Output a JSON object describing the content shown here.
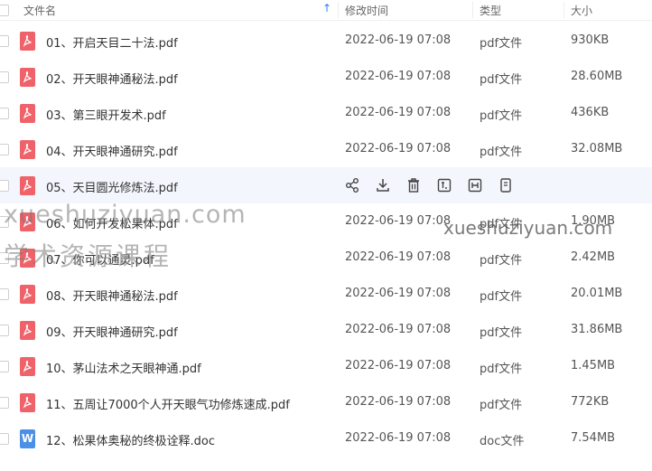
{
  "header": {
    "name_label": "文件名",
    "sort_indicator": "↑",
    "modified_label": "修改时间",
    "type_label": "类型",
    "size_label": "大小"
  },
  "files": [
    {
      "name": "01、开启天目二十法.pdf",
      "modified": "2022-06-19 07:08",
      "type": "pdf文件",
      "size": "930KB",
      "icon": "pdf-file-icon"
    },
    {
      "name": "02、开天眼神通秘法.pdf",
      "modified": "2022-06-19 07:08",
      "type": "pdf文件",
      "size": "28.60MB",
      "icon": "pdf-file-icon"
    },
    {
      "name": "03、第三眼开发术.pdf",
      "modified": "2022-06-19 07:08",
      "type": "pdf文件",
      "size": "436KB",
      "icon": "pdf-file-icon"
    },
    {
      "name": "04、开天眼神通研究.pdf",
      "modified": "2022-06-19 07:08",
      "type": "pdf文件",
      "size": "32.08MB",
      "icon": "pdf-file-icon"
    },
    {
      "name": "05、天目圆光修炼法.pdf",
      "modified": "",
      "type": "",
      "size": "",
      "icon": "pdf-file-icon",
      "hovered": true
    },
    {
      "name": "06、如何开发松果体.pdf",
      "modified": "2022-06-19 07:08",
      "type": "pdf文件",
      "size": "1.90MB",
      "icon": "pdf-file-icon"
    },
    {
      "name": "07、你可以通灵.pdf",
      "modified": "2022-06-19 07:08",
      "type": "pdf文件",
      "size": "2.42MB",
      "icon": "pdf-file-icon"
    },
    {
      "name": "08、开天眼神通秘法.pdf",
      "modified": "2022-06-19 07:08",
      "type": "pdf文件",
      "size": "20.01MB",
      "icon": "pdf-file-icon"
    },
    {
      "name": "09、开天眼神通研究.pdf",
      "modified": "2022-06-19 07:08",
      "type": "pdf文件",
      "size": "31.86MB",
      "icon": "pdf-file-icon"
    },
    {
      "name": "10、茅山法术之天眼神通.pdf",
      "modified": "2022-06-19 07:08",
      "type": "pdf文件",
      "size": "1.45MB",
      "icon": "pdf-file-icon"
    },
    {
      "name": "11、五周让7000个人开天眼气功修炼速成.pdf",
      "modified": "2022-06-19 07:08",
      "type": "pdf文件",
      "size": "772KB",
      "icon": "pdf-file-icon"
    },
    {
      "name": "12、松果体奥秘的终极诠释.doc",
      "modified": "2022-06-19 07:08",
      "type": "doc文件",
      "size": "7.54MB",
      "icon": "word-file-icon"
    }
  ],
  "row_actions": [
    "share-icon",
    "download-icon",
    "delete-icon",
    "rename-icon",
    "move-icon",
    "copy-icon"
  ],
  "watermarks": {
    "left_url": "xueshuziyuan.com",
    "left_text": "学术资源课程",
    "right_url": "xueshuziyuan.com"
  },
  "colors": {
    "pdf": "#f0626a",
    "doc": "#4a90e8",
    "accent": "#2b7cff",
    "hover_row": "#f3f6fd"
  }
}
